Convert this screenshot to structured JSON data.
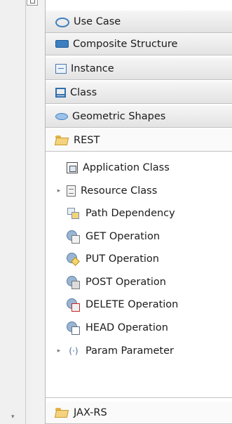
{
  "palette": {
    "drawers": [
      {
        "label": "Use Case",
        "icon": "use-case-icon"
      },
      {
        "label": "Composite Structure",
        "icon": "composite-structure-icon"
      },
      {
        "label": "Instance",
        "icon": "instance-icon"
      },
      {
        "label": "Class",
        "icon": "class-icon"
      },
      {
        "label": "Geometric Shapes",
        "icon": "geometric-shapes-icon"
      }
    ],
    "open_drawer": {
      "label": "REST",
      "icon": "folder-open-icon"
    },
    "tools": [
      {
        "label": "Application Class",
        "icon": "application-class-icon",
        "expandable": false
      },
      {
        "label": "Resource Class",
        "icon": "resource-class-icon",
        "expandable": true
      },
      {
        "label": "Path Dependency",
        "icon": "path-dependency-icon",
        "expandable": false
      },
      {
        "label": "GET Operation",
        "icon": "get-operation-icon",
        "expandable": false
      },
      {
        "label": "PUT Operation",
        "icon": "put-operation-icon",
        "expandable": false
      },
      {
        "label": "POST Operation",
        "icon": "post-operation-icon",
        "expandable": false
      },
      {
        "label": "DELETE Operation",
        "icon": "delete-operation-icon",
        "expandable": false
      },
      {
        "label": "HEAD Operation",
        "icon": "head-operation-icon",
        "expandable": false
      },
      {
        "label": "Param Parameter",
        "icon": "param-parameter-icon",
        "expandable": true
      }
    ],
    "bottom_drawer": {
      "label": "JAX-RS",
      "icon": "folder-open-icon"
    }
  },
  "glyphs": {
    "expand": "▸",
    "scroll_down": "▾",
    "param": "(·)",
    "delete_mark": "✖"
  },
  "colors": {
    "accent": "#3d7fc0",
    "folder": "#f4d27e",
    "panel_bg": "#ffffff",
    "drawer_bg": "#e9e9e9"
  }
}
